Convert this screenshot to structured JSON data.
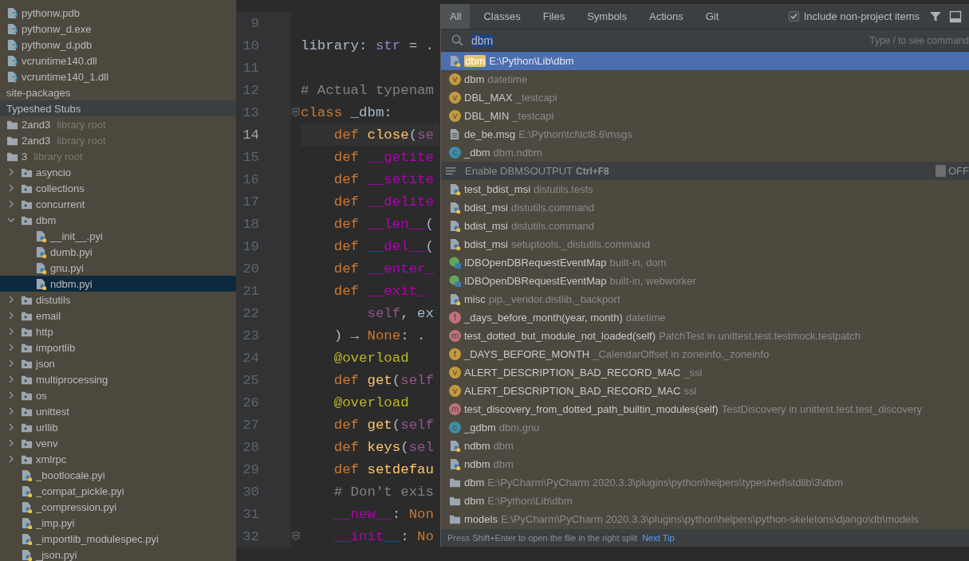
{
  "project_tree": [
    {
      "children": [
        {
          "name": "pythonw.pdb",
          "kind": "unknown-file",
          "selected": false,
          "highlighted": false
        },
        {
          "name": "pythonw_d.exe",
          "kind": "unknown-file",
          "selected": false,
          "highlighted": false
        },
        {
          "name": "pythonw_d.pdb",
          "kind": "unknown-file",
          "selected": false,
          "highlighted": false
        },
        {
          "name": "vcruntime140.dll",
          "kind": "unknown-file",
          "selected": false,
          "highlighted": false
        },
        {
          "name": "vcruntime140_1.dll",
          "kind": "unknown-file",
          "selected": false,
          "highlighted": false
        }
      ]
    },
    {
      "name": "site-packages",
      "selected": false,
      "highlighted": false
    },
    {
      "name": "Typeshed Stubs",
      "selected": false,
      "highlighted": true,
      "children": [
        {
          "name": "2and3",
          "hint": "library root",
          "kind": "folder",
          "selected": false,
          "highlighted": false
        },
        {
          "name": "2and3",
          "hint": "library root",
          "kind": "folder",
          "selected": false,
          "highlighted": false
        },
        {
          "name": "3",
          "hint": "library root",
          "kind": "folder",
          "selected": false,
          "highlighted": false,
          "children": [
            {
              "name": "asyncio",
              "kind": "package",
              "expanded": false,
              "selected": false,
              "highlighted": false
            },
            {
              "name": "collections",
              "kind": "package",
              "expanded": false,
              "selected": false,
              "highlighted": false
            },
            {
              "name": "concurrent",
              "kind": "package",
              "expanded": false,
              "selected": false,
              "highlighted": false
            },
            {
              "name": "dbm",
              "kind": "package",
              "expanded": true,
              "selected": false,
              "highlighted": false,
              "children": [
                {
                  "name": "__init__.pyi",
                  "kind": "python-file",
                  "selected": false,
                  "highlighted": false
                },
                {
                  "name": "dumb.pyi",
                  "kind": "python-file",
                  "selected": false,
                  "highlighted": false
                },
                {
                  "name": "gnu.pyi",
                  "kind": "python-file",
                  "selected": false,
                  "highlighted": false
                },
                {
                  "name": "ndbm.pyi",
                  "kind": "python-file",
                  "selected": true,
                  "highlighted": false
                }
              ]
            },
            {
              "name": "distutils",
              "kind": "package",
              "expanded": false,
              "selected": false,
              "highlighted": false
            },
            {
              "name": "email",
              "kind": "package",
              "expanded": false,
              "selected": false,
              "highlighted": false
            },
            {
              "name": "http",
              "kind": "package",
              "expanded": false,
              "selected": false,
              "highlighted": false
            },
            {
              "name": "importlib",
              "kind": "package",
              "expanded": false,
              "selected": false,
              "highlighted": false
            },
            {
              "name": "json",
              "kind": "package",
              "expanded": false,
              "selected": false,
              "highlighted": false
            },
            {
              "name": "multiprocessing",
              "kind": "package",
              "expanded": false,
              "selected": false,
              "highlighted": false
            },
            {
              "name": "os",
              "kind": "package",
              "expanded": false,
              "selected": false,
              "highlighted": false
            },
            {
              "name": "unittest",
              "kind": "package",
              "expanded": false,
              "selected": false,
              "highlighted": false
            },
            {
              "name": "urllib",
              "kind": "package",
              "expanded": false,
              "selected": false,
              "highlighted": false
            },
            {
              "name": "venv",
              "kind": "package",
              "expanded": false,
              "selected": false,
              "highlighted": false
            },
            {
              "name": "xmlrpc",
              "kind": "package",
              "expanded": false,
              "selected": false,
              "highlighted": false
            },
            {
              "name": "_bootlocale.pyi",
              "kind": "python-file",
              "selected": false,
              "highlighted": false
            },
            {
              "name": "_compat_pickle.pyi",
              "kind": "python-file",
              "selected": false,
              "highlighted": false
            },
            {
              "name": "_compression.pyi",
              "kind": "python-file",
              "selected": false,
              "highlighted": false
            },
            {
              "name": "_imp.pyi",
              "kind": "python-file",
              "selected": false,
              "highlighted": false
            },
            {
              "name": "_importlib_modulespec.pyi",
              "kind": "python-file",
              "selected": false,
              "highlighted": false
            },
            {
              "name": "_json.pyi",
              "kind": "python-file",
              "selected": false,
              "highlighted": false
            }
          ]
        }
      ]
    }
  ],
  "editor": {
    "lines": [
      {
        "number": "9",
        "current": false,
        "fold": false
      },
      {
        "number": "10",
        "current": false,
        "fold": false,
        "tokens": [
          {
            "kind": "plain",
            "text": "library: "
          },
          {
            "kind": "type",
            "text": "str"
          },
          {
            "kind": "plain",
            "text": " = ."
          }
        ]
      },
      {
        "number": "11",
        "current": false,
        "fold": false
      },
      {
        "number": "12",
        "current": false,
        "fold": false,
        "tokens": [
          {
            "kind": "comment",
            "text": "# Actual typenam"
          }
        ]
      },
      {
        "number": "13",
        "current": false,
        "fold": true,
        "tokens": [
          {
            "kind": "keyword",
            "text": "class"
          },
          {
            "kind": "plain",
            "text": " _dbm:"
          }
        ]
      },
      {
        "number": "14",
        "current": true,
        "fold": false,
        "tokens": [
          {
            "kind": "keyword",
            "text": "    def"
          },
          {
            "kind": "function",
            "text": " close"
          },
          {
            "kind": "plain",
            "text": "("
          },
          {
            "kind": "self",
            "text": "se"
          }
        ]
      },
      {
        "number": "15",
        "current": false,
        "fold": false,
        "tokens": [
          {
            "kind": "keyword",
            "text": "    def"
          },
          {
            "kind": "magic",
            "text": " __getite"
          }
        ]
      },
      {
        "number": "16",
        "current": false,
        "fold": false,
        "tokens": [
          {
            "kind": "keyword",
            "text": "    def"
          },
          {
            "kind": "magic",
            "text": " __setite"
          }
        ]
      },
      {
        "number": "17",
        "current": false,
        "fold": false,
        "tokens": [
          {
            "kind": "keyword",
            "text": "    def"
          },
          {
            "kind": "magic",
            "text": " __delite"
          }
        ]
      },
      {
        "number": "18",
        "current": false,
        "fold": false,
        "tokens": [
          {
            "kind": "keyword",
            "text": "    def"
          },
          {
            "kind": "magic",
            "text": " __len__"
          },
          {
            "kind": "plain",
            "text": "("
          }
        ]
      },
      {
        "number": "19",
        "current": false,
        "fold": false,
        "tokens": [
          {
            "kind": "keyword",
            "text": "    def"
          },
          {
            "kind": "magic",
            "text": " __del__"
          },
          {
            "kind": "plain",
            "text": "("
          }
        ]
      },
      {
        "number": "20",
        "current": false,
        "fold": false,
        "tokens": [
          {
            "kind": "keyword",
            "text": "    def"
          },
          {
            "kind": "magic",
            "text": " __enter_"
          }
        ]
      },
      {
        "number": "21",
        "current": false,
        "fold": false,
        "tokens": [
          {
            "kind": "keyword",
            "text": "    def"
          },
          {
            "kind": "magic",
            "text": " __exit_"
          }
        ]
      },
      {
        "number": "22",
        "current": false,
        "fold": false,
        "tokens": [
          {
            "kind": "self",
            "text": "        self"
          },
          {
            "kind": "plain",
            "text": ", ex"
          }
        ]
      },
      {
        "number": "23",
        "current": false,
        "fold": false,
        "tokens": [
          {
            "kind": "plain",
            "text": "    ) → "
          },
          {
            "kind": "keyword",
            "text": "None"
          },
          {
            "kind": "plain",
            "text": ": ."
          }
        ]
      },
      {
        "number": "24",
        "current": false,
        "fold": false,
        "tokens": [
          {
            "kind": "decorator",
            "text": "    @overload"
          }
        ]
      },
      {
        "number": "25",
        "current": false,
        "fold": false,
        "tokens": [
          {
            "kind": "keyword",
            "text": "    def"
          },
          {
            "kind": "function",
            "text": " get"
          },
          {
            "kind": "plain",
            "text": "("
          },
          {
            "kind": "self",
            "text": "self"
          }
        ]
      },
      {
        "number": "26",
        "current": false,
        "fold": false,
        "tokens": [
          {
            "kind": "decorator",
            "text": "    @overload"
          }
        ]
      },
      {
        "number": "27",
        "current": false,
        "fold": false,
        "tokens": [
          {
            "kind": "keyword",
            "text": "    def"
          },
          {
            "kind": "function",
            "text": " get"
          },
          {
            "kind": "plain",
            "text": "("
          },
          {
            "kind": "self",
            "text": "self"
          }
        ]
      },
      {
        "number": "28",
        "current": false,
        "fold": false,
        "tokens": [
          {
            "kind": "keyword",
            "text": "    def"
          },
          {
            "kind": "function",
            "text": " keys"
          },
          {
            "kind": "plain",
            "text": "("
          },
          {
            "kind": "self",
            "text": "sel"
          }
        ]
      },
      {
        "number": "29",
        "current": false,
        "fold": false,
        "tokens": [
          {
            "kind": "keyword",
            "text": "    def"
          },
          {
            "kind": "function",
            "text": " setdefau"
          }
        ]
      },
      {
        "number": "30",
        "current": false,
        "fold": false,
        "tokens": [
          {
            "kind": "comment",
            "text": "    # Don't exis"
          }
        ]
      },
      {
        "number": "31",
        "current": false,
        "fold": false,
        "tokens": [
          {
            "kind": "magic",
            "text": "    __new__"
          },
          {
            "kind": "plain",
            "text": ": "
          },
          {
            "kind": "keyword",
            "text": "Non"
          }
        ]
      },
      {
        "number": "32",
        "current": false,
        "fold": true,
        "tokens": [
          {
            "kind": "magic",
            "text": "    __init__"
          },
          {
            "kind": "plain",
            "text": ": "
          },
          {
            "kind": "keyword",
            "text": "No"
          }
        ]
      }
    ]
  },
  "search_popup": {
    "tabs": [
      {
        "label": "All",
        "selected": true
      },
      {
        "label": "Classes",
        "selected": false
      },
      {
        "label": "Files",
        "selected": false
      },
      {
        "label": "Symbols",
        "selected": false
      },
      {
        "label": "Actions",
        "selected": false
      },
      {
        "label": "Git",
        "selected": false
      }
    ],
    "include_checkbox": {
      "label": "Include non-project items",
      "checked": true
    },
    "search": {
      "value": "dbm",
      "hint": "Type / to see command"
    },
    "results": [
      {
        "kind": "python-file",
        "name": "dbm",
        "location": "E:\\Python\\Lib\\dbm",
        "selected": true,
        "match": true
      },
      {
        "kind": "variable",
        "badge": "v",
        "name": "dbm",
        "location": "datetime",
        "selected": false,
        "match": false
      },
      {
        "kind": "variable",
        "badge": "v",
        "name": "DBL_MAX",
        "location": "_testcapi",
        "selected": false,
        "match": false
      },
      {
        "kind": "variable",
        "badge": "v",
        "name": "DBL_MIN",
        "location": "_testcapi",
        "selected": false,
        "match": false
      },
      {
        "kind": "text-file",
        "name": "de_be.msg",
        "location": "E:\\Python\\tcl\\tcl8.6\\msgs",
        "selected": false,
        "match": false
      },
      {
        "kind": "class",
        "badge": "c",
        "name": "_dbm",
        "location": "dbm.ndbm",
        "selected": false,
        "match": false
      },
      {
        "kind": "action",
        "name": "Enable DBMSOUTPUT",
        "shortcut": "Ctrl+F8",
        "toggle": {
          "on": false,
          "label": "OFF"
        }
      },
      {
        "kind": "python-file",
        "name": "test_bdist_msi",
        "location": "distutils.tests",
        "selected": false,
        "match": false
      },
      {
        "kind": "python-file",
        "name": "bdist_msi",
        "location": "distutils.command",
        "selected": false,
        "match": false
      },
      {
        "kind": "python-file",
        "name": "bdist_msi",
        "location": "distutils.command",
        "selected": false,
        "match": false
      },
      {
        "kind": "python-file",
        "name": "bdist_msi",
        "location": "setuptools._distutils.command",
        "selected": false,
        "match": false
      },
      {
        "kind": "interface",
        "name": "IDBOpenDBRequestEventMap",
        "location": "built-in, dom",
        "selected": false,
        "match": false
      },
      {
        "kind": "interface",
        "name": "IDBOpenDBRequestEventMap",
        "location": "built-in, webworker",
        "selected": false,
        "match": false
      },
      {
        "kind": "python-file",
        "name": "misc",
        "location": "pip._vendor.distlib._backport",
        "selected": false,
        "match": false
      },
      {
        "kind": "function",
        "badge": "f",
        "name": "_days_before_month(year, month)",
        "location": "datetime",
        "selected": false,
        "match": false
      },
      {
        "kind": "method",
        "badge": "m",
        "name": "test_dotted_but_module_not_loaded(self)",
        "location": "PatchTest in unittest.test.testmock.testpatch",
        "selected": false,
        "match": false
      },
      {
        "kind": "field",
        "badge": "f",
        "name": "_DAYS_BEFORE_MONTH",
        "location": "_CalendarOffset in zoneinfo._zoneinfo",
        "selected": false,
        "match": false
      },
      {
        "kind": "variable",
        "badge": "v",
        "name": "ALERT_DESCRIPTION_BAD_RECORD_MAC",
        "location": "_ssl",
        "selected": false,
        "match": false
      },
      {
        "kind": "variable",
        "badge": "v",
        "name": "ALERT_DESCRIPTION_BAD_RECORD_MAC",
        "location": "ssl",
        "selected": false,
        "match": false
      },
      {
        "kind": "method",
        "badge": "m",
        "name": "test_discovery_from_dotted_path_builtin_modules(self)",
        "location": "TestDiscovery in unittest.test.test_discovery",
        "selected": false,
        "match": false
      },
      {
        "kind": "class",
        "badge": "c",
        "name": "_gdbm",
        "location": "dbm.gnu",
        "selected": false,
        "match": false
      },
      {
        "kind": "python-file",
        "name": "ndbm",
        "location": "dbm",
        "selected": false,
        "match": false
      },
      {
        "kind": "python-file",
        "name": "ndbm",
        "location": "dbm",
        "selected": false,
        "match": false
      },
      {
        "kind": "folder",
        "name": "dbm",
        "location": "E:\\PyCharm\\PyCharm 2020.3.3\\plugins\\python\\helpers\\typeshed\\stdlib\\3\\dbm",
        "selected": false,
        "match": false
      },
      {
        "kind": "folder",
        "name": "dbm",
        "location": "E:\\Python\\Lib\\dbm",
        "selected": false,
        "match": false
      },
      {
        "kind": "folder",
        "name": "models",
        "location": "E:\\PyCharm\\PyCharm 2020.3.3\\plugins\\python\\helpers\\python-skeletons\\django\\db\\models",
        "selected": false,
        "match": false
      }
    ],
    "footer": {
      "tip": "Press Shift+Enter to open the file in the right split",
      "link": "Next Tip"
    }
  }
}
